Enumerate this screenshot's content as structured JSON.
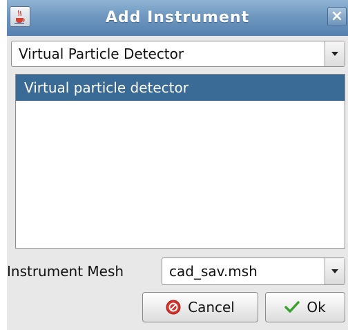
{
  "window": {
    "title": "Add Instrument",
    "close_glyph": "×",
    "icon": "java-coffee-cup-icon"
  },
  "instrument_type": {
    "selected": "Virtual Particle Detector"
  },
  "instrument_list": {
    "items": [
      {
        "label": "Virtual particle detector",
        "selected": true
      }
    ]
  },
  "mesh": {
    "label": "Instrument Mesh",
    "selected": "cad_sav.msh"
  },
  "buttons": {
    "cancel": {
      "label": "Cancel",
      "icon": "cancel-icon"
    },
    "ok": {
      "label": "Ok",
      "icon": "checkmark-icon"
    }
  },
  "colors": {
    "titlebar": "#6f98c0",
    "selection": "#3a6a96",
    "cancel_icon": "#d9302a",
    "ok_icon": "#3aa12e"
  }
}
